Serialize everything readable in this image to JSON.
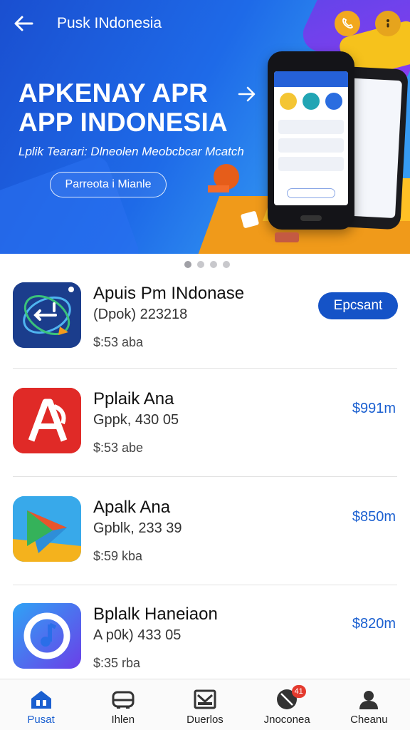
{
  "hero": {
    "title": "Pusk INdonesia",
    "headline_line1": "APKENAY APR",
    "headline_line2": "APP INDONESIA",
    "subline": "Lplik Tearari: Dlneolen Meobcbcar Mcatch",
    "cta_label": "Parreota i Mianle",
    "carousel_pages": 4,
    "carousel_active": 1
  },
  "apps": [
    {
      "name": "Apuis Pm INdonase",
      "developer": "(Dpok) 223218",
      "size": "$:53 aba",
      "action": "Epcsant",
      "icon": "app-refresh-icon"
    },
    {
      "name": "Pplaik Ana",
      "developer": "Gppk, 430 05",
      "size": "$:53 abe",
      "price": "$991m",
      "icon": "app-a-letter-icon"
    },
    {
      "name": "Apalk Ana",
      "developer": "Gpblk, 233 39",
      "size": "$:59 kba",
      "price": "$850m",
      "icon": "app-play-icon"
    },
    {
      "name": "Bplalk Haneiaon",
      "developer": "A p0k) 433 05",
      "size": "$:35 rba",
      "price": "$820m",
      "icon": "app-music-icon"
    }
  ],
  "nav": {
    "items": [
      {
        "label": "Pusat",
        "icon": "home-icon",
        "active": true
      },
      {
        "label": "Ihlen",
        "icon": "inbox-icon"
      },
      {
        "label": "Duerlos",
        "icon": "mail-icon"
      },
      {
        "label": "Jnoconea",
        "icon": "compass-icon",
        "badge": "41"
      },
      {
        "label": "Cheanu",
        "icon": "profile-icon"
      }
    ]
  },
  "colors": {
    "brand": "#1553c7",
    "price": "#1a5fd0",
    "badge": "#e43a2e",
    "hero_accent": "#f2a81e"
  }
}
